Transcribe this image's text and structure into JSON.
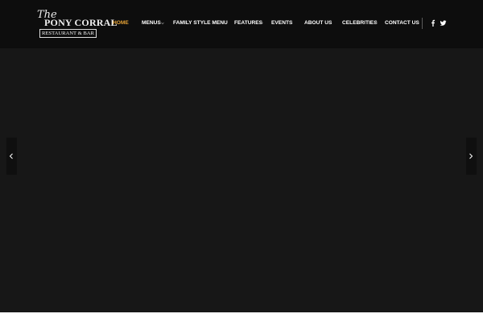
{
  "logo": {
    "script": "The",
    "main": "PONY CORRAL",
    "sub": "RESTAURANT & BAR"
  },
  "nav": {
    "items": [
      {
        "label": "HOME",
        "active": true,
        "has_dropdown": false
      },
      {
        "label": "MENUS",
        "active": false,
        "has_dropdown": true
      },
      {
        "label": "FAMILY STYLE MENU",
        "active": false,
        "has_dropdown": false
      },
      {
        "label": "FEATURES",
        "active": false,
        "has_dropdown": true
      },
      {
        "label": "EVENTS",
        "active": false,
        "has_dropdown": false
      },
      {
        "label": "ABOUT US",
        "active": false,
        "has_dropdown": false
      },
      {
        "label": "CELEBRITIES",
        "active": false,
        "has_dropdown": true
      },
      {
        "label": "CONTACT US",
        "active": false,
        "has_dropdown": false
      }
    ]
  },
  "social": {
    "icons": [
      "facebook-icon",
      "twitter-icon"
    ]
  },
  "slider": {
    "prev_icon": "chevron-left-icon",
    "next_icon": "chevron-right-icon"
  },
  "colors": {
    "header_bg": "#0d0d0d",
    "hero_bg": "#171717",
    "accent": "#e6a336",
    "nav_text": "#ffffff"
  }
}
